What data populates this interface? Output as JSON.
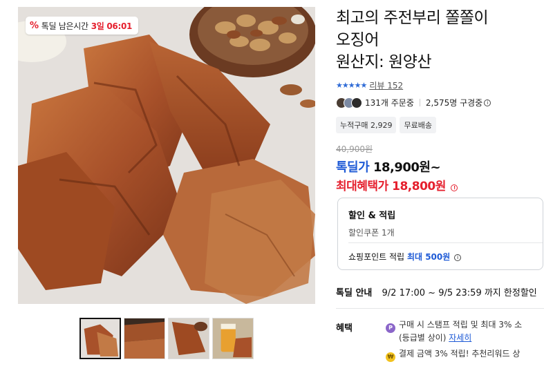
{
  "deal_badge": {
    "icon": "percent-icon",
    "label": "톡딜 남은시간",
    "time": "3일 06:01"
  },
  "product": {
    "title_lines": [
      "최고의 주전부리 쫄쫄이",
      "오징어",
      "원산지: 원양산"
    ],
    "rating_stars": "★★★★★",
    "review_text": "리뷰 152",
    "buyers_text": "131개 주문중",
    "subscribers_text": "2,575명 구경중",
    "tags": [
      "누적구매 2,929",
      "무료배송"
    ],
    "original_price": "40,900원",
    "deal_label": "톡딜가",
    "deal_price": "18,900원~",
    "max_label": "최대혜택가",
    "max_price": "18,800원"
  },
  "discount_box": {
    "heading": "할인 & 적립",
    "coupon": "할인쿠폰 1개",
    "points_prefix": "쇼핑포인트 적립",
    "points_highlight": "최대 500원"
  },
  "deal_info": {
    "label": "톡딜 안내",
    "text": "9/2 17:00 ~ 9/5 23:59 까지 한정할인"
  },
  "benefits": {
    "label": "혜택",
    "line1": "구매 시 스탬프 적립 및 최대 3% 소",
    "line1b_prefix": "(등급별 상이)",
    "line1b_link": "자세히",
    "line2": "결제 금액 3% 적립! 추천리워드 상"
  },
  "thumbnails": [
    "thumb-1",
    "thumb-2",
    "thumb-3",
    "thumb-4"
  ],
  "colors": {
    "accent_blue": "#1f5bd6",
    "accent_red": "#e5202e"
  }
}
